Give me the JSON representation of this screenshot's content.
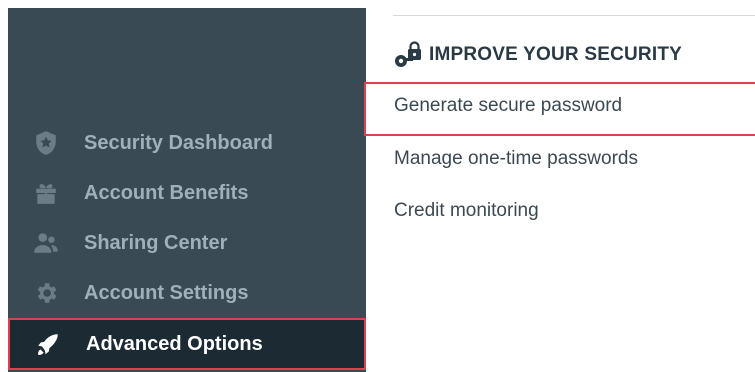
{
  "sidebar": {
    "items": [
      {
        "label": "Security Dashboard",
        "icon": "shield-star-icon"
      },
      {
        "label": "Account Benefits",
        "icon": "gift-icon"
      },
      {
        "label": "Sharing Center",
        "icon": "users-icon"
      },
      {
        "label": "Account Settings",
        "icon": "gear-icon"
      },
      {
        "label": "Advanced Options",
        "icon": "rocket-icon",
        "active": true
      }
    ]
  },
  "main": {
    "section_title": "IMPROVE YOUR SECURITY",
    "section_icon": "key-lock-icon",
    "links": [
      {
        "label": "Generate secure password",
        "highlighted": true
      },
      {
        "label": "Manage one-time passwords"
      },
      {
        "label": "Credit monitoring"
      }
    ]
  },
  "colors": {
    "sidebar_bg": "#3a4a54",
    "active_bg": "#1b2a33",
    "highlight": "#e0404e"
  }
}
